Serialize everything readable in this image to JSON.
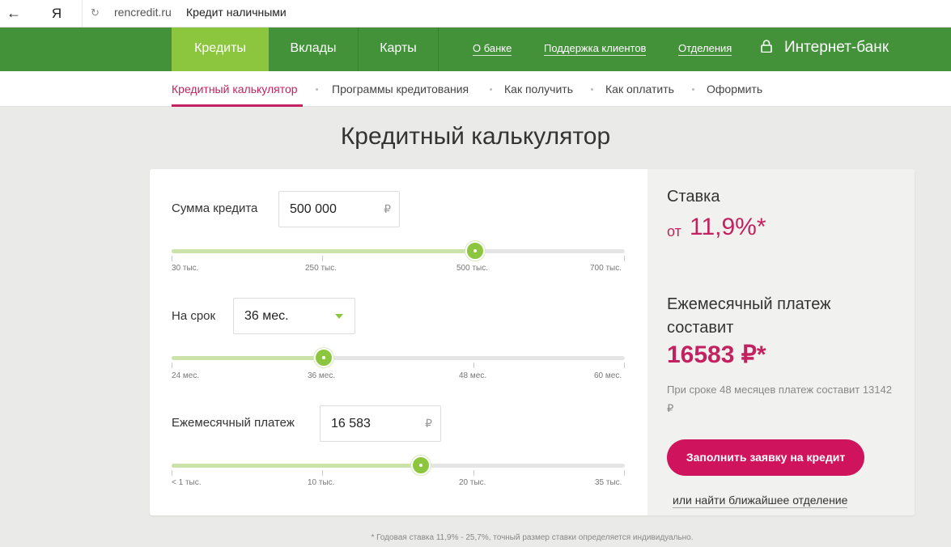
{
  "browser": {
    "back_icon": "arrow-left-icon",
    "back_glyph": "←",
    "logo_text": "Я",
    "reload_glyph": "↻",
    "url_domain": "rencredit.ru",
    "tab_title": "Кредит наличными"
  },
  "nav": {
    "tabs": [
      {
        "label": "Кредиты",
        "active": true
      },
      {
        "label": "Вклады",
        "active": false
      },
      {
        "label": "Карты",
        "active": false
      }
    ],
    "links": [
      "О банке",
      "Поддержка клиентов",
      "Отделения"
    ],
    "ibank_label": "Интернет-банк"
  },
  "subnav": {
    "items": [
      "Кредитный калькулятор",
      "Программы кредитования",
      "Как получить",
      "Как оплатить",
      "Оформить"
    ],
    "active_index": 0
  },
  "page_title": "Кредитный калькулятор",
  "calculator": {
    "amount": {
      "label": "Сумма кредита",
      "value": "500 000",
      "unit": "₽",
      "slider_fraction": 0.67,
      "ticks": [
        "30 тыс.",
        "250 тыс.",
        "500 тыс.",
        "700 тыс."
      ]
    },
    "term": {
      "label": "На срок",
      "value": "36 мес.",
      "slider_fraction": 0.335,
      "ticks": [
        "24 мес.",
        "36 мес.",
        "48 мес.",
        "60 мес."
      ]
    },
    "payment": {
      "label": "Ежемесячный платеж",
      "value": "16 583",
      "unit": "₽",
      "slider_fraction": 0.55,
      "ticks": [
        "< 1 тыс.",
        "10 тыс.",
        "20 тыс.",
        "35 тыс."
      ]
    }
  },
  "summary": {
    "rate_label": "Ставка",
    "rate_prefix": "от",
    "rate_value": "11,9%*",
    "monthly_label": "Ежемесячный платеж составит",
    "monthly_value": "16583 ₽*",
    "note": "При сроке 48 месяцев платеж составит 13142 ₽",
    "apply_button": "Заполнить заявку на кредит",
    "branch_link": "или найти ближайшее отделение"
  },
  "footnote": "* Годовая ставка 11,9% - 25,7%, точный размер ставки определяется индивидуально.",
  "colors": {
    "nav_green": "#43923a",
    "active_green": "#8cc63f",
    "accent_magenta": "#c2225f",
    "button_magenta": "#d0135d"
  }
}
